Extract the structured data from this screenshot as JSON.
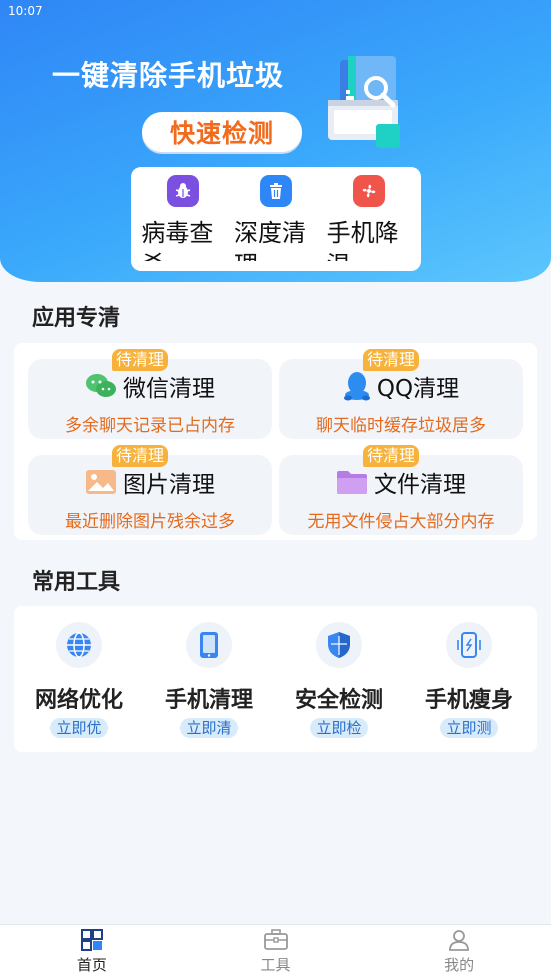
{
  "status_bar": {
    "time": "10:07"
  },
  "hero": {
    "title": "一键清除手机垃圾",
    "quick_scan_label": "快速检测"
  },
  "features": [
    {
      "label": "病毒查杀",
      "icon": "bug-icon",
      "color": "#7b4fe0"
    },
    {
      "label": "深度清理",
      "icon": "trash-icon",
      "color": "#2f86f6"
    },
    {
      "label": "手机降温",
      "icon": "fan-icon",
      "color": "#f0554c"
    }
  ],
  "apps_section": {
    "title": "应用专清",
    "badge_label": "待清理",
    "items": [
      {
        "name": "微信清理",
        "desc": "多余聊天记录已占内存",
        "icon": "wechat-icon"
      },
      {
        "name": "QQ清理",
        "desc": "聊天临时缓存垃圾居多",
        "icon": "qq-icon"
      },
      {
        "name": "图片清理",
        "desc": "最近删除图片残余过多",
        "icon": "picture-icon"
      },
      {
        "name": "文件清理",
        "desc": "无用文件侵占大部分内存",
        "icon": "folder-icon"
      }
    ]
  },
  "tools_section": {
    "title": "常用工具",
    "items": [
      {
        "name": "网络优化",
        "action": "立即优",
        "icon": "globe-icon"
      },
      {
        "name": "手机清理",
        "action": "立即清",
        "icon": "phone-icon"
      },
      {
        "name": "安全检测",
        "action": "立即检",
        "icon": "shield-icon"
      },
      {
        "name": "手机瘦身",
        "action": "立即测",
        "icon": "phone-vibrate-icon"
      }
    ]
  },
  "tabbar": {
    "items": [
      {
        "label": "首页",
        "icon": "home-grid-icon",
        "active": true
      },
      {
        "label": "工具",
        "icon": "toolbox-icon",
        "active": false
      },
      {
        "label": "我的",
        "icon": "user-icon",
        "active": false
      }
    ]
  },
  "colors": {
    "accent": "#2f86f6",
    "orange": "#f26a1b",
    "badge": "#f7b23b"
  }
}
